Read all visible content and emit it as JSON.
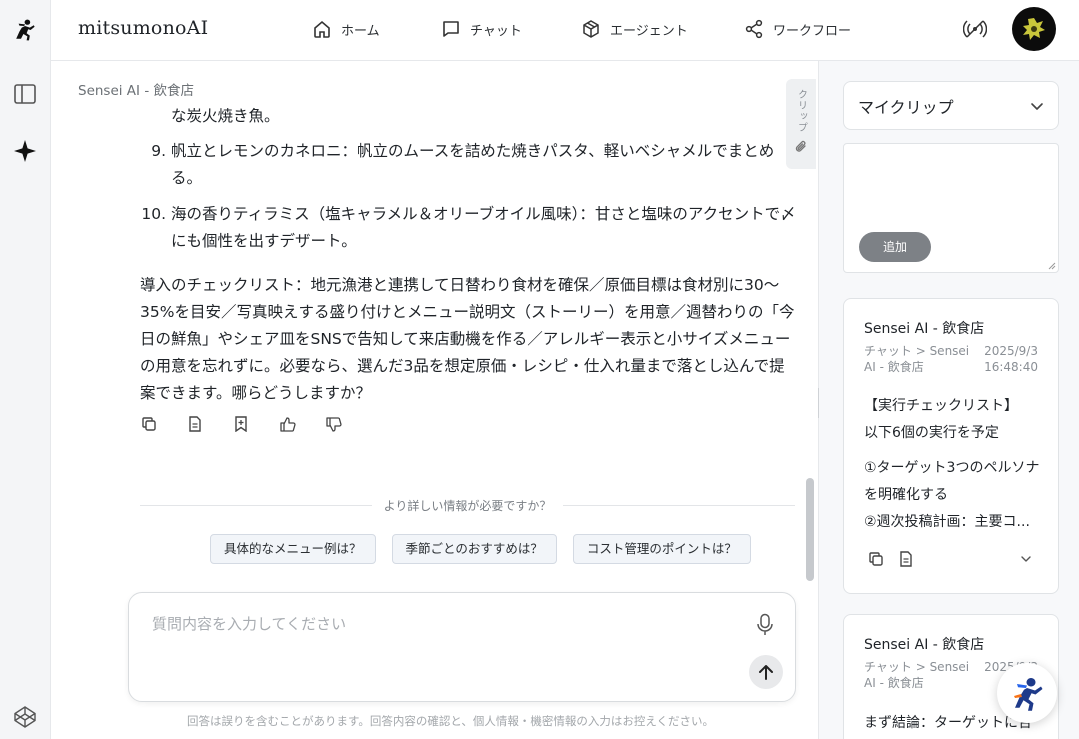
{
  "app": {
    "brand": "mitsumonoAI"
  },
  "nav": [
    {
      "label": "ホーム",
      "icon": "home-icon"
    },
    {
      "label": "チャット",
      "icon": "chat-icon"
    },
    {
      "label": "エージェント",
      "icon": "cube-icon"
    },
    {
      "label": "ワークフロー",
      "icon": "share-icon"
    }
  ],
  "chat": {
    "breadcrumb": "Sensei AI - 飲食店",
    "list_items": [
      {
        "num": "",
        "text": "な炭火焼き魚。"
      },
      {
        "num": "9.",
        "text": "帆立とレモンのカネロニ：帆立のムースを詰めた焼きパスタ、軽いベシャメルでまとめる。"
      },
      {
        "num": "10.",
        "text": "海の香りティラミス（塩キャラメル＆オリーブオイル風味）：甘さと塩味のアクセントで〆にも個性を出すデザート。"
      }
    ],
    "paragraph": "導入のチェックリスト：地元漁港と連携して日替わり食材を確保／原価目標は食材別に30〜35%を目安／写真映えする盛り付けとメニュー説明文（ストーリー）を用意／週替わりの「今日の鮮魚」やシェア皿をSNSで告知して来店動機を作る／アレルギー表示と小サイズメニューの用意を忘れずに。必要なら、選んだ3品を想定原価・レシピ・仕入れ量まで落とし込んで提案できます。哪らどうしますか？",
    "more_info_label": "より詳しい情報が必要ですか？",
    "suggestions": [
      "具体的なメニュー例は？",
      "季節ごとのおすすめは？",
      "コスト管理のポイントは？"
    ],
    "input_placeholder": "質問内容を入力してください",
    "disclaimer": "回答は誤りを含むことがあります。回答内容の確認と、個人情報・機密情報の入力はお控えください。"
  },
  "clip_tab": {
    "label": "クリップ"
  },
  "right_panel": {
    "select_label": "マイクリップ",
    "add_button": "追加",
    "cards": [
      {
        "title": "Sensei AI - 飲食店",
        "path": "チャット > Sensei AI - 飲食店",
        "date": "2025/9/3 16:48:40",
        "body": [
          "【実行チェックリスト】",
          "以下6個の実行を予定",
          "①ターゲット3つのペルソナを明確化する",
          "②週次投稿計画：主要コ..."
        ]
      },
      {
        "title": "Sensei AI - 飲食店",
        "path": "チャット > Sensei AI - 飲食店",
        "date": "2025/9/3 16:",
        "body": [
          "まず結論：ターゲットに合"
        ]
      }
    ]
  },
  "colors": {
    "accent": "#1f2328",
    "chip_bg": "#f2f5f9",
    "panel_bg": "#f7f8fa",
    "add_button_bg": "#7d8186"
  }
}
